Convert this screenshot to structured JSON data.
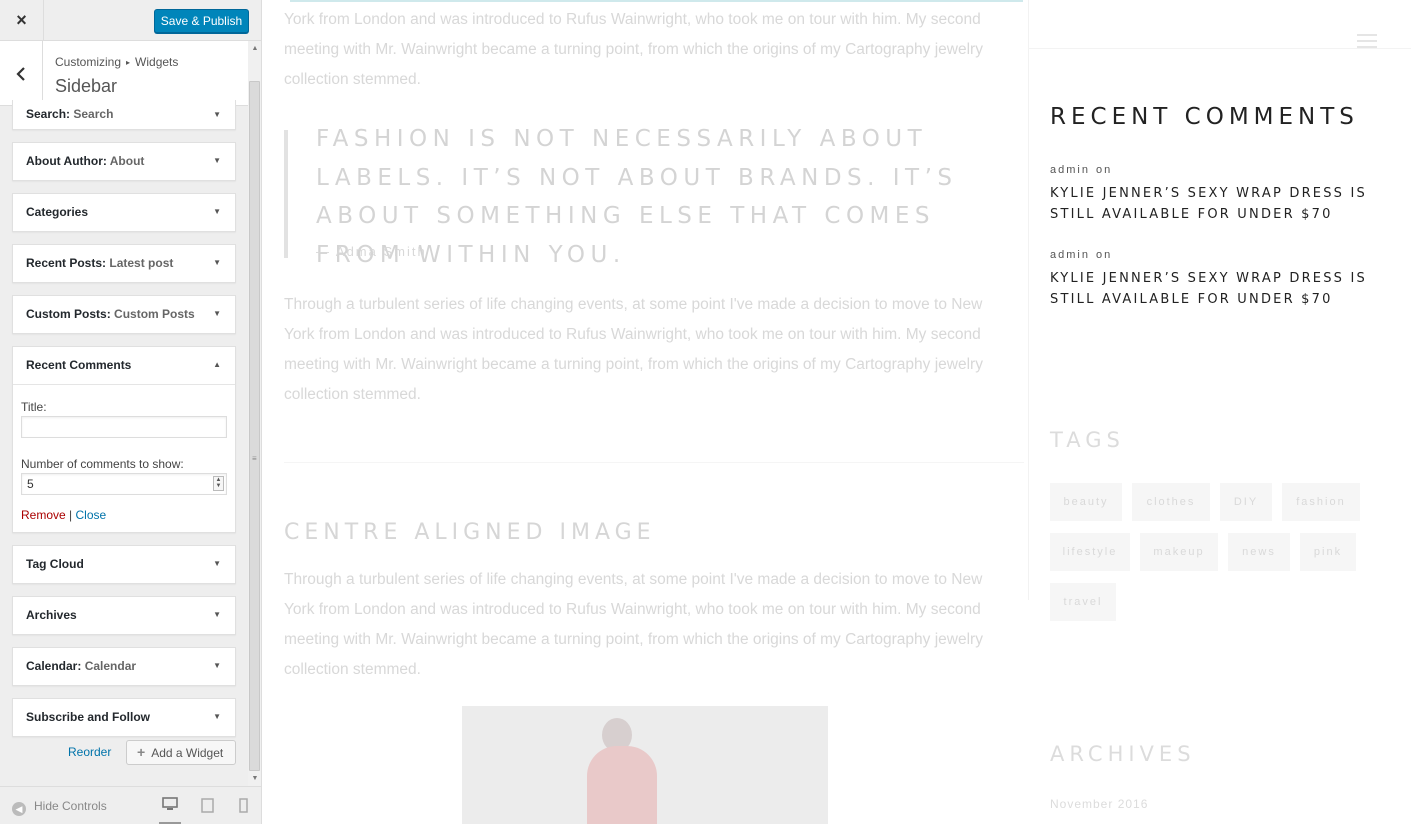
{
  "customizer": {
    "close_icon": "×",
    "save_label": "Save & Publish",
    "back_icon": "‹",
    "breadcrumb_root": "Customizing",
    "breadcrumb_sep": "▸",
    "breadcrumb_current": "Widgets",
    "section_title": "Sidebar",
    "accent": "#0085ba"
  },
  "widgets": [
    {
      "name": "Search",
      "instance": "Search",
      "expanded": false
    },
    {
      "name": "About Author",
      "instance": "About",
      "expanded": false
    },
    {
      "name": "Categories",
      "instance": "",
      "expanded": false
    },
    {
      "name": "Recent Posts",
      "instance": "Latest post",
      "expanded": false
    },
    {
      "name": "Custom Posts",
      "instance": "Custom Posts",
      "expanded": false
    },
    {
      "name": "Recent Comments",
      "instance": "",
      "expanded": true
    },
    {
      "name": "Tag Cloud",
      "instance": "",
      "expanded": false
    },
    {
      "name": "Archives",
      "instance": "",
      "expanded": false
    },
    {
      "name": "Calendar",
      "instance": "Calendar",
      "expanded": false
    },
    {
      "name": "Subscribe and Follow",
      "instance": "",
      "expanded": false
    }
  ],
  "recent_comments_form": {
    "title_label": "Title:",
    "title_value": "",
    "number_label": "Number of comments to show:",
    "number_value": "5",
    "remove_label": "Remove",
    "separator": "|",
    "close_label": "Close"
  },
  "widget_actions": {
    "reorder_label": "Reorder",
    "add_label": "Add a Widget"
  },
  "footer": {
    "hide_controls_label": "Hide Controls",
    "devices": [
      "desktop",
      "tablet",
      "mobile"
    ],
    "active_device": "desktop"
  },
  "preview": {
    "para_top": "York from London and was introduced to Rufus Wainwright, who took me on tour with him. My second meeting with Mr. Wainwright became a turning point, from which the origins of my Cartography jewelry collection stemmed.",
    "quote": "FASHION IS NOT NECESSARILY ABOUT LABELS. IT’S NOT ABOUT BRANDS. IT’S ABOUT SOMETHING ELSE THAT COMES FROM WITHIN YOU.",
    "quote_author": "— Adma Smith",
    "para_middle": "Through a turbulent series of life changing events, at some point I've made a decision to move to New York from London and was introduced to Rufus Wainwright, who took me on tour with him. My second meeting with Mr. Wainwright became a turning point, from which the origins of my Cartography jewelry collection stemmed.",
    "centre_heading": "CENTRE ALIGNED IMAGE",
    "para_bottom": "Through a turbulent series of life changing events, at some point I've made a decision to move to New York from London and was introduced to Rufus Wainwright, who took me on tour with him. My second meeting with Mr. Wainwright became a turning point, from which the origins of my Cartography jewelry collection stemmed."
  },
  "sidebar_preview": {
    "recent_comments_heading": "RECENT COMMENTS",
    "comments": [
      {
        "author": "admin",
        "on": "on",
        "title": "KYLIE JENNER’S SEXY WRAP DRESS IS STILL AVAILABLE FOR UNDER $70"
      },
      {
        "author": "admin",
        "on": "on",
        "title": "KYLIE JENNER’S SEXY WRAP DRESS IS STILL AVAILABLE FOR UNDER $70"
      }
    ],
    "tags_heading": "TAGS",
    "tags": [
      "beauty",
      "clothes",
      "DIY",
      "fashion",
      "lifestyle",
      "makeup",
      "news",
      "pink",
      "travel"
    ],
    "archives_heading": "ARCHIVES",
    "archives_item": "November 2016"
  }
}
